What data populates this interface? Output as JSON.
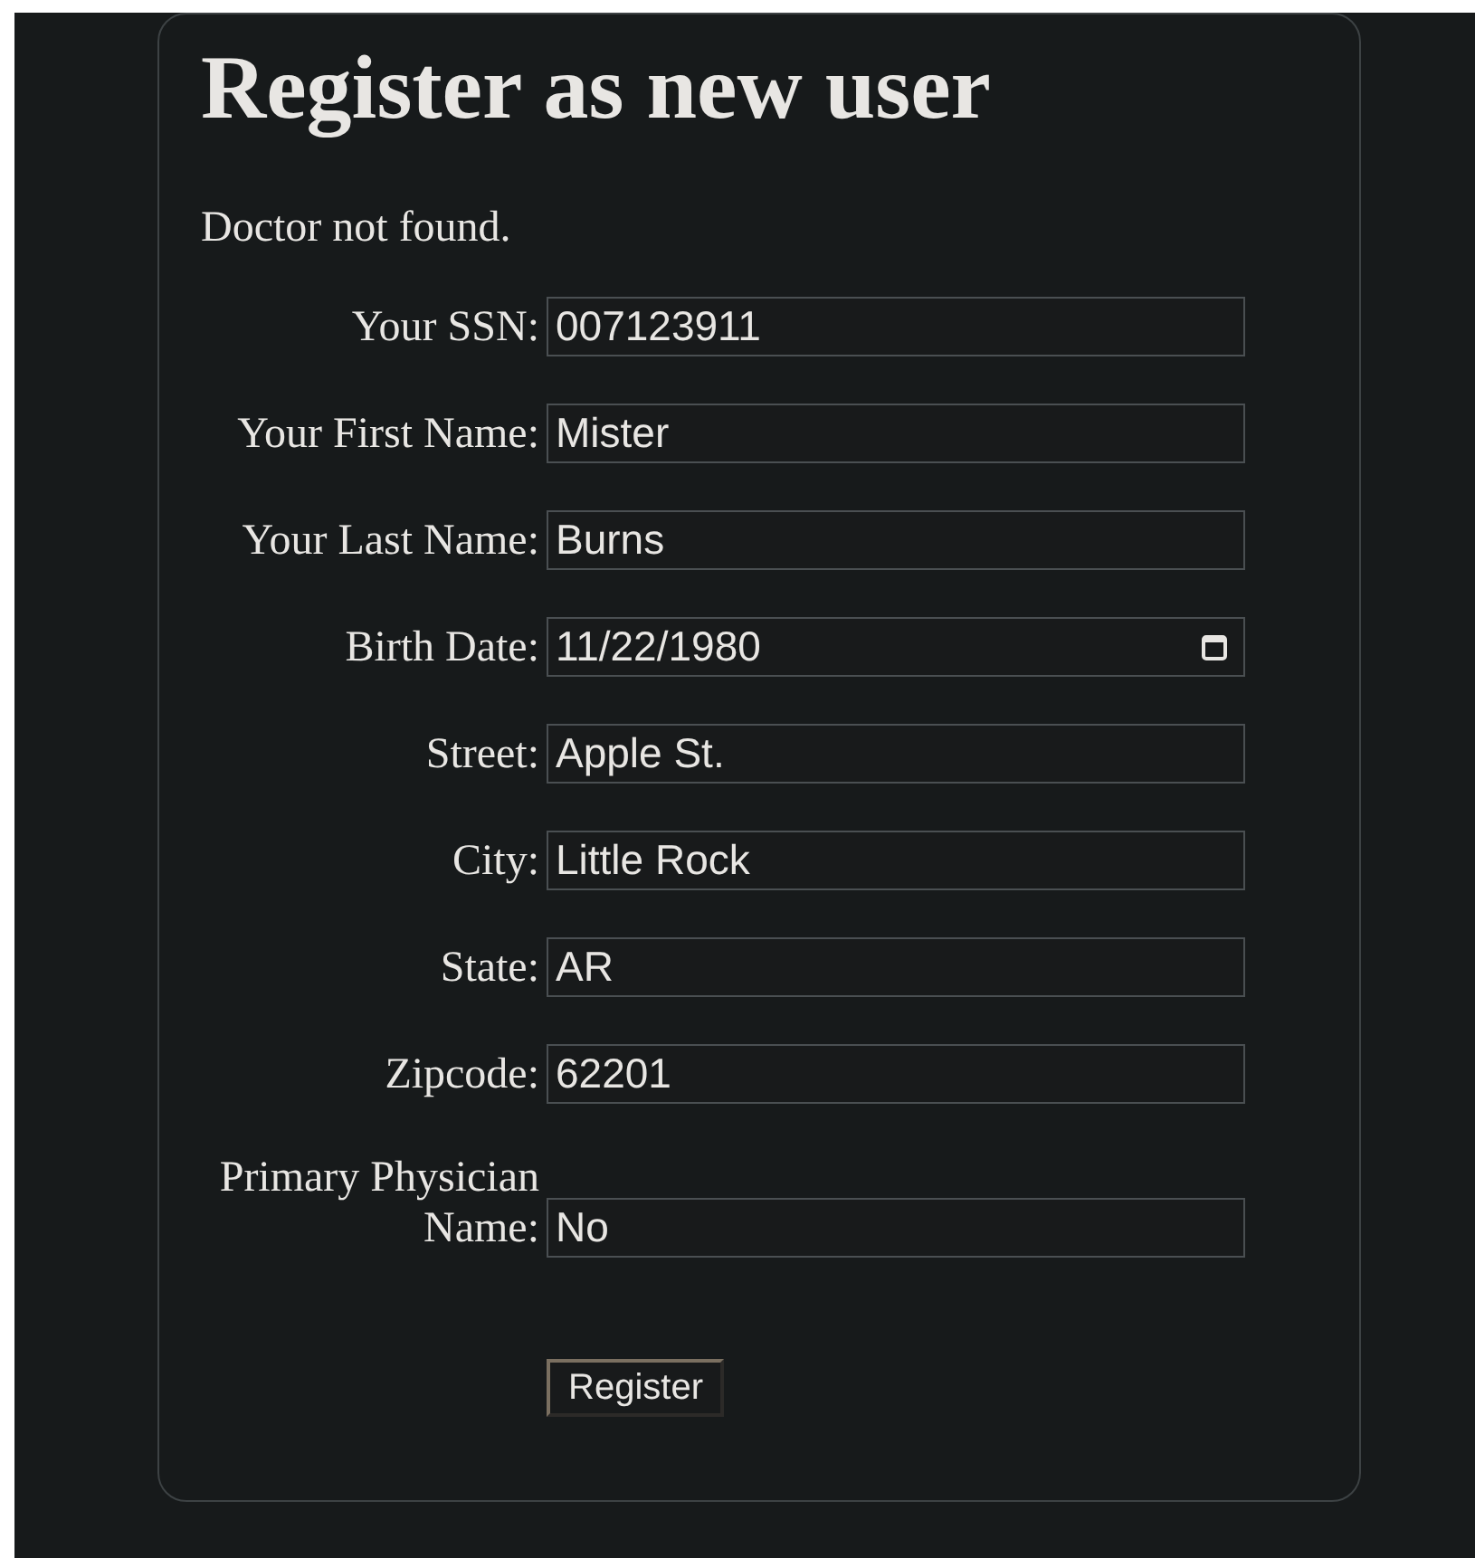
{
  "heading": "Register as new user",
  "message": "Doctor not found.",
  "fields": [
    {
      "label": "Your SSN:",
      "value": "007123911",
      "kind": "text"
    },
    {
      "label": "Your First Name:",
      "value": "Mister",
      "kind": "text"
    },
    {
      "label": "Your Last Name:",
      "value": "Burns",
      "kind": "text"
    },
    {
      "label": "Birth Date:",
      "value": "11/22/1980",
      "kind": "date"
    },
    {
      "label": "Street:",
      "value": "Apple St.",
      "kind": "text"
    },
    {
      "label": "City:",
      "value": "Little Rock",
      "kind": "text"
    },
    {
      "label": "State:",
      "value": "AR",
      "kind": "text"
    },
    {
      "label": "Zipcode:",
      "value": "62201",
      "kind": "text"
    },
    {
      "label": "Primary Physician Name:",
      "value": "No",
      "kind": "text"
    }
  ],
  "button": "Register"
}
